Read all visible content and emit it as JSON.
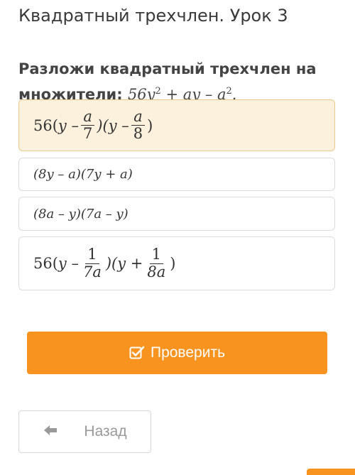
{
  "header": {
    "title": "Квадратный трехчлен. Урок 3"
  },
  "question": {
    "text": "Разложи квадратный трехчлен на множители:",
    "expression_main": "56y",
    "expression_exp1": "2",
    "expression_mid": " + ay – a",
    "expression_exp2": "2",
    "expression_end": "."
  },
  "options": [
    {
      "selected": true,
      "coef": "56(",
      "part1": "y –",
      "frac1_num": "a",
      "frac1_den": "7",
      "part2": ")(y –",
      "frac2_num": "a",
      "frac2_den": "8",
      "part3": ")"
    },
    {
      "selected": false,
      "text": "(8y – a)(7y + a)"
    },
    {
      "selected": false,
      "text": "(8a – y)(7a – y)"
    },
    {
      "selected": false,
      "coef": "56(",
      "part1": "y –",
      "frac1_num": "1",
      "frac1_den": "7a",
      "part2": ")(y +",
      "frac2_num": "1",
      "frac2_den": "8a",
      "part3": ")"
    }
  ],
  "buttons": {
    "check_label": "Проверить",
    "back_label": "Назад"
  },
  "colors": {
    "accent": "#f7931e",
    "selected_bg": "#fbf1dc",
    "selected_border": "#eac98d"
  },
  "icons": {
    "check": "checkbox-check-icon",
    "back": "arrow-left-icon"
  }
}
